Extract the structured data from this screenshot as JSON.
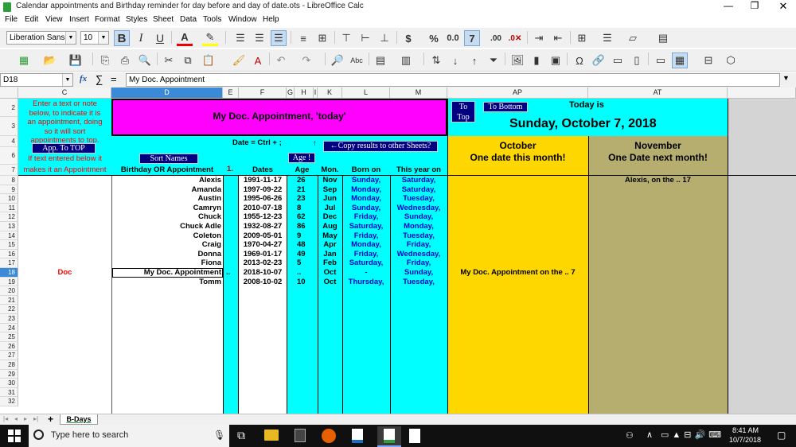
{
  "window": {
    "title": "Calendar appointments and Birthday reminder for day before and day of date.ots - LibreOffice Calc"
  },
  "menu": [
    "File",
    "Edit",
    "View",
    "Insert",
    "Format",
    "Styles",
    "Sheet",
    "Data",
    "Tools",
    "Window",
    "Help"
  ],
  "toolbar": {
    "font_name": "Liberation Sans",
    "font_size": "10"
  },
  "formula_bar": {
    "name_box": "D18",
    "fx": "fx",
    "sigma": "∑",
    "equals": "=",
    "content": "My Doc. Appointment"
  },
  "columns": [
    "C",
    "D",
    "E",
    "F",
    "G",
    "H",
    "I",
    "K",
    "L",
    "M",
    "AP",
    "AT"
  ],
  "rows": [
    "2",
    "3",
    "4",
    "6",
    "7",
    "8",
    "9",
    "10",
    "11",
    "12",
    "13",
    "14",
    "15",
    "16",
    "17",
    "18",
    "19",
    "20",
    "21",
    "22",
    "23",
    "24",
    "25",
    "26",
    "27",
    "28",
    "29",
    "30",
    "31",
    "32"
  ],
  "sheet": {
    "note_line1": "Enter a text or note",
    "note_line2": "below, to indicate it is",
    "note_line3": "an appointment, doing",
    "note_line4": "so it will sort",
    "note_line5": "appointments to top.",
    "app_to_top": "App. To TOP",
    "if_text_1": "If text entered below it",
    "if_text_2": "makes it an Appointment",
    "banner": "My Doc. Appointment, 'today'",
    "sort_names": "Sort Names",
    "birthday_header": "Birthday OR Appointment",
    "date_ctrl": "Date = Ctrl + ;",
    "arrow_up": "↑",
    "copy_results": "←Copy results  to other Sheets?",
    "age_btn": "Age !",
    "marker_1": "1.",
    "h_dates": "Dates",
    "h_age": "Age",
    "h_mon": "Mon.",
    "h_born": "Born on",
    "h_this_year": "This year on",
    "to_top_1": "To",
    "to_top_2": "Top",
    "to_bottom": "To Bottom",
    "today_is": "Today is",
    "today_date": "Sunday, October 7, 2018",
    "month1": "October",
    "month1_sub": "One date this month!",
    "month2": "November",
    "month2_sub": "One Date next month!",
    "ap_note": "My Doc. Appointment on the  ..  7",
    "at_note": "Alexis, on the  ..  17",
    "doc_label": "Doc"
  },
  "records": [
    {
      "name": "Alexis",
      "date": "1991-11-17",
      "age": "26",
      "mon": "Nov",
      "born": "Sunday,",
      "this_year": "Saturday,"
    },
    {
      "name": "Amanda",
      "date": "1997-09-22",
      "age": "21",
      "mon": "Sep",
      "born": "Monday,",
      "this_year": "Saturday,"
    },
    {
      "name": "Austin",
      "date": "1995-06-26",
      "age": "23",
      "mon": "Jun",
      "born": "Monday,",
      "this_year": "Tuesday,"
    },
    {
      "name": "Camryn",
      "date": "2010-07-18",
      "age": "8",
      "mon": "Jul",
      "born": "Sunday,",
      "this_year": "Wednesday,"
    },
    {
      "name": "Chuck",
      "date": "1955-12-23",
      "age": "62",
      "mon": "Dec",
      "born": "Friday,",
      "this_year": "Sunday,"
    },
    {
      "name": "Chuck Adle",
      "date": "1932-08-27",
      "age": "86",
      "mon": "Aug",
      "born": "Saturday,",
      "this_year": "Monday,"
    },
    {
      "name": "Coleton",
      "date": "2009-05-01",
      "age": "9",
      "mon": "May",
      "born": "Friday,",
      "this_year": "Tuesday,"
    },
    {
      "name": "Craig",
      "date": "1970-04-27",
      "age": "48",
      "mon": "Apr",
      "born": "Monday,",
      "this_year": "Friday,"
    },
    {
      "name": "Donna",
      "date": "1969-01-17",
      "age": "49",
      "mon": "Jan",
      "born": "Friday,",
      "this_year": "Wednesday,"
    },
    {
      "name": "Fiona",
      "date": "2013-02-23",
      "age": "5",
      "mon": "Feb",
      "born": "Saturday,",
      "this_year": "Friday,"
    },
    {
      "name": "My Doc. Appointment",
      "date": "2018-10-07",
      "age": "..",
      "mon": "Oct",
      "born": "-",
      "this_year": "Sunday,"
    },
    {
      "name": "Tomm",
      "date": "2008-10-02",
      "age": "10",
      "mon": "Oct",
      "born": "Thursday,",
      "this_year": "Tuesday,"
    }
  ],
  "row18_e": "..",
  "sheet_tab": "B-Days",
  "taskbar": {
    "search_placeholder": "Type here to search",
    "time": "8:41 AM",
    "date": "10/7/2018"
  },
  "colors": {
    "cyan": "#00ffff",
    "magenta": "#ff00ff",
    "gold": "#ffd700",
    "olive": "#b5ae6e",
    "red": "#ff0000",
    "navy": "#000080"
  }
}
